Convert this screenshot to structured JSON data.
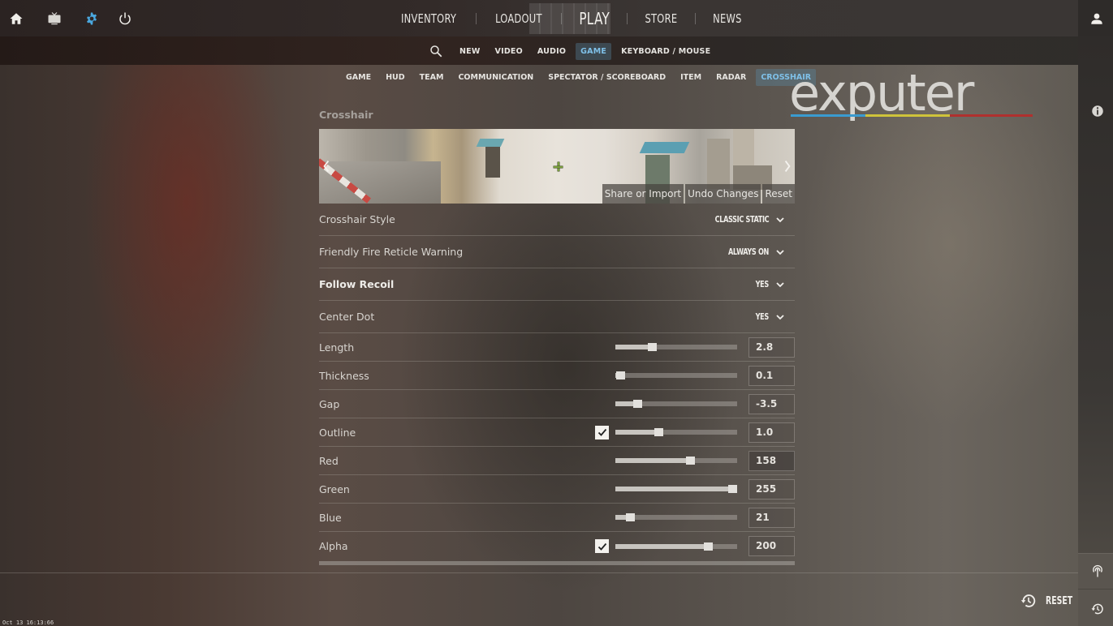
{
  "top_nav": {
    "left_icons": [
      {
        "name": "home-icon"
      },
      {
        "name": "tv-icon"
      },
      {
        "name": "settings-icon",
        "active": true,
        "color": "#4aa8e0"
      },
      {
        "name": "power-icon"
      }
    ],
    "items": [
      {
        "label": "INVENTORY"
      },
      {
        "label": "LOADOUT"
      },
      {
        "label": "PLAY"
      },
      {
        "label": "STORE"
      },
      {
        "label": "NEWS"
      }
    ],
    "right_icon": "profile-icon"
  },
  "settings_categories": {
    "search_icon": "search-icon",
    "items": [
      {
        "label": "NEW"
      },
      {
        "label": "VIDEO"
      },
      {
        "label": "AUDIO"
      },
      {
        "label": "GAME",
        "active": true
      },
      {
        "label": "KEYBOARD / MOUSE"
      }
    ]
  },
  "game_tabs": {
    "items": [
      {
        "label": "GAME"
      },
      {
        "label": "HUD"
      },
      {
        "label": "TEAM"
      },
      {
        "label": "COMMUNICATION"
      },
      {
        "label": "SPECTATOR / SCOREBOARD"
      },
      {
        "label": "ITEM"
      },
      {
        "label": "RADAR"
      },
      {
        "label": "CROSSHAIR",
        "active": true
      }
    ],
    "active_color": "#7fc0e8"
  },
  "section": {
    "title": "Crosshair",
    "preview": {
      "actions": [
        {
          "label": "Share or Import"
        },
        {
          "label": "Undo Changes"
        },
        {
          "label": "Reset"
        }
      ]
    }
  },
  "dropdown_settings": [
    {
      "label": "Crosshair Style",
      "value": "CLASSIC STATIC",
      "bold": false
    },
    {
      "label": "Friendly Fire Reticle Warning",
      "value": "ALWAYS ON",
      "bold": false
    },
    {
      "label": "Follow Recoil",
      "value": "YES",
      "bold": true
    },
    {
      "label": "Center Dot",
      "value": "YES",
      "bold": false
    }
  ],
  "slider_settings": [
    {
      "label": "Length",
      "value": "2.8",
      "fraction": 0.3,
      "checkbox": false
    },
    {
      "label": "Thickness",
      "value": "0.1",
      "fraction": 0.04,
      "checkbox": false
    },
    {
      "label": "Gap",
      "value": "-3.5",
      "fraction": 0.18,
      "checkbox": false
    },
    {
      "label": "Outline",
      "value": "1.0",
      "fraction": 0.35,
      "checkbox": true,
      "checked": true
    },
    {
      "label": "Red",
      "value": "158",
      "fraction": 0.61,
      "checkbox": false
    },
    {
      "label": "Green",
      "value": "255",
      "fraction": 0.96,
      "checkbox": false
    },
    {
      "label": "Blue",
      "value": "21",
      "fraction": 0.12,
      "checkbox": false
    },
    {
      "label": "Alpha",
      "value": "200",
      "fraction": 0.76,
      "checkbox": true,
      "checked": true
    }
  ],
  "side_rail": {
    "icons": [
      "info-icon",
      "broadcast-icon",
      "history-icon"
    ]
  },
  "footer": {
    "reset_label": "RESET",
    "timestamp": "Oct 13 16:13:66"
  },
  "watermark": {
    "text": "exputer",
    "bar_colors": [
      "#3a9bd0",
      "#cfc33a",
      "#b0302e"
    ]
  }
}
